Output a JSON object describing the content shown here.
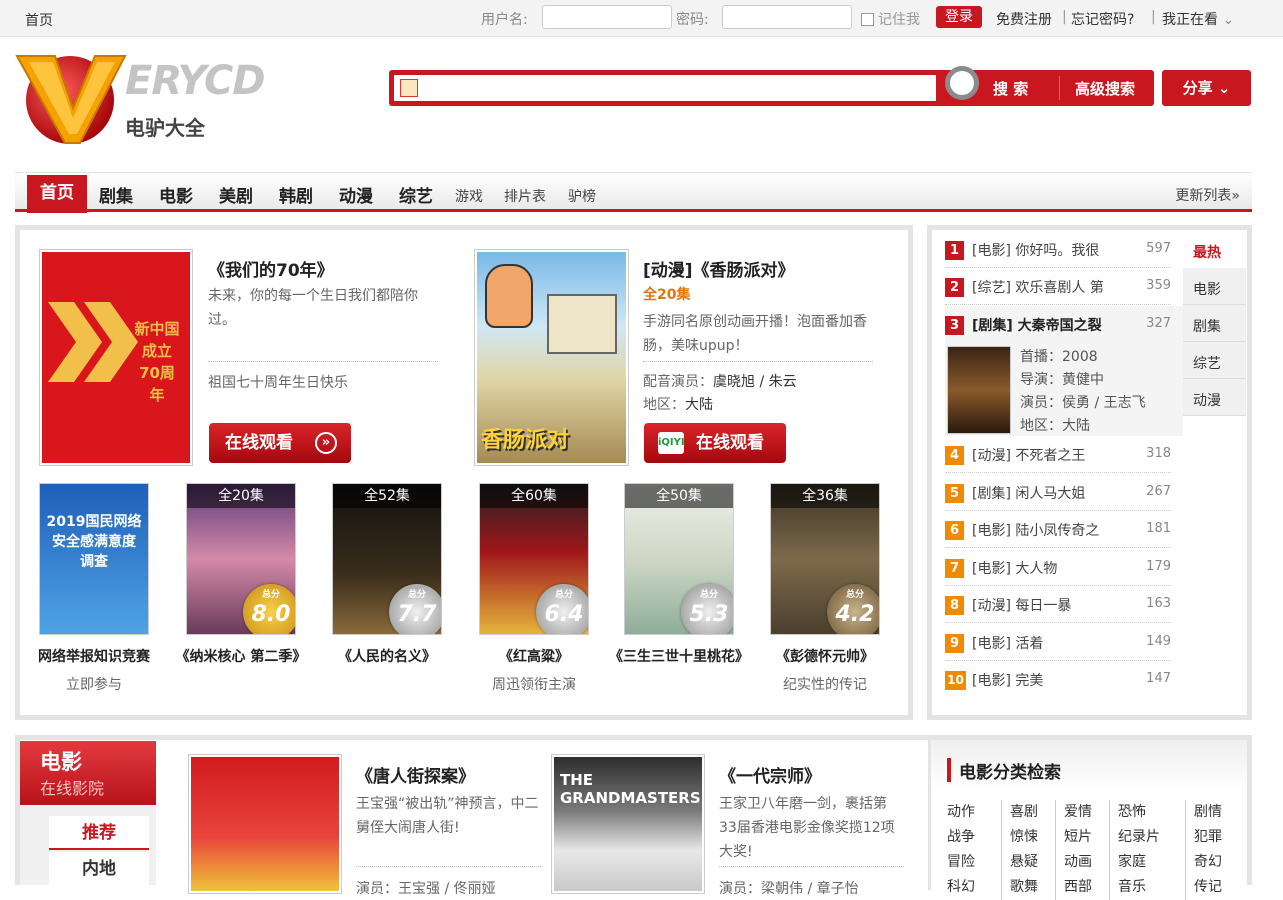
{
  "topbar": {
    "home": "首页",
    "username_label": "用户名:",
    "password_label": "密码:",
    "remember": "记住我",
    "login": "登录",
    "register": "免费注册",
    "forgot": "忘记密码?",
    "watching": "我正在看"
  },
  "logo": {
    "brand": "ERYCD",
    "subtitle": "电驴大全"
  },
  "search": {
    "button": "搜 索",
    "advanced": "高级搜索",
    "share": "分享"
  },
  "nav": {
    "active": "首页",
    "main": [
      "剧集",
      "电影",
      "美剧",
      "韩剧",
      "动漫",
      "综艺"
    ],
    "minor": [
      "游戏",
      "排片表",
      "驴榜"
    ],
    "more": "更新列表»"
  },
  "featured": [
    {
      "title": "《我们的70年》",
      "desc": "未来，你的每一个生日我们都陪你过。",
      "extra": "祖国七十周年生日快乐",
      "watch": "在线观看",
      "poster": "新中国成立70周年"
    },
    {
      "title": "[动漫]《香肠派对》",
      "eps": "全20集",
      "desc": "手游同名原创动画开播！泡面番加香肠，美味upup！",
      "cast_label": "配音演员：",
      "cast": "虞晓旭 / 朱云",
      "region_label": "地区：",
      "region": "大陆",
      "watch": "在线观看"
    }
  ],
  "thumbs": [
    {
      "title": "网络举报知识竞赛",
      "sub": "立即参与",
      "eps": "",
      "score": "",
      "poster": "2019国民网络安全感满意度调查"
    },
    {
      "title": "《纳米核心 第二季》",
      "sub": "",
      "eps": "全20集",
      "score": "8.0"
    },
    {
      "title": "《人民的名义》",
      "sub": "",
      "eps": "全52集",
      "score": "7.7"
    },
    {
      "title": "《红高粱》",
      "sub": "周迅领衔主演",
      "eps": "全60集",
      "score": "6.4"
    },
    {
      "title": "《三生三世十里桃花》",
      "sub": "",
      "eps": "全50集",
      "score": "5.3"
    },
    {
      "title": "《彭德怀元帅》",
      "sub": "纪实性的传记",
      "eps": "全36集",
      "score": "4.2"
    }
  ],
  "score_label": "总分",
  "ranking": [
    {
      "n": "1",
      "text": "[电影] 你好吗。我很",
      "count": "597"
    },
    {
      "n": "2",
      "text": "[综艺] 欢乐喜剧人 第",
      "count": "359"
    },
    {
      "n": "3",
      "text": "[剧集] 大秦帝国之裂",
      "count": "327"
    },
    {
      "n": "4",
      "text": "[动漫] 不死者之王",
      "count": "318"
    },
    {
      "n": "5",
      "text": "[剧集] 闲人马大姐",
      "count": "267"
    },
    {
      "n": "6",
      "text": "[电影] 陆小凤传奇之",
      "count": "181"
    },
    {
      "n": "7",
      "text": "[电影] 大人物",
      "count": "179"
    },
    {
      "n": "8",
      "text": "[动漫] 每日一暴",
      "count": "163"
    },
    {
      "n": "9",
      "text": "[电影] 活着",
      "count": "149"
    },
    {
      "n": "10",
      "text": "[电影] 完美",
      "count": "147"
    }
  ],
  "rank_detail": {
    "premiere": "首播：2008",
    "director": "导演：黄健中",
    "cast": "演员：侯勇 / 王志飞",
    "region": "地区：大陆"
  },
  "rank_tabs": [
    "最热",
    "电影",
    "剧集",
    "综艺",
    "动漫"
  ],
  "movie": {
    "section_title": "电影",
    "section_sub": "在线影院",
    "tabs": [
      "推荐",
      "内地"
    ],
    "items": [
      {
        "title": "《唐人街探案》",
        "desc": "王宝强“被出轨”神预言，中二舅侄大闹唐人街!",
        "cast": "演员：王宝强 / 佟丽娅"
      },
      {
        "title": "《一代宗师》",
        "desc": "王家卫八年磨一剑，裹括第33届香港电影金像奖揽12项大奖!",
        "cast": "演员：梁朝伟 / 章子怡"
      }
    ],
    "poster2_title": "THE GRANDMASTERS",
    "category_title": "电影分类检索",
    "categories": [
      [
        "动作",
        "喜剧",
        "爱情",
        "恐怖",
        "剧情"
      ],
      [
        "战争",
        "惊悚",
        "短片",
        "纪录片",
        "犯罪"
      ],
      [
        "冒险",
        "悬疑",
        "动画",
        "家庭",
        "奇幻"
      ],
      [
        "科幻",
        "歌舞",
        "西部",
        "音乐",
        "传记"
      ]
    ]
  }
}
